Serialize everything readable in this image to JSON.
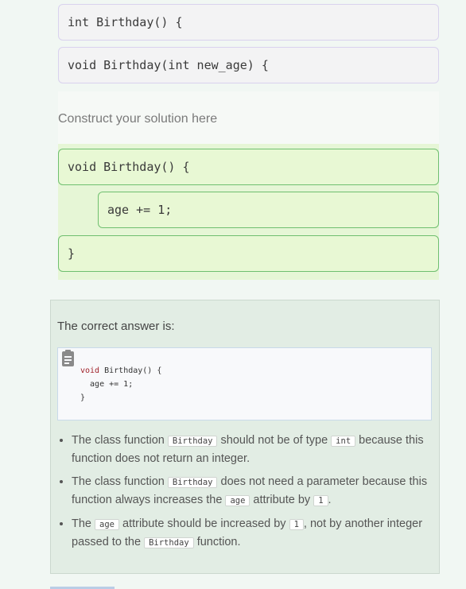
{
  "source_blocks": [
    "int Birthday() {",
    "void Birthday(int new_age) {"
  ],
  "construct_label": "Construct your solution here",
  "solution_blocks": [
    "void Birthday() {",
    "age += 1;",
    "}"
  ],
  "feedback": {
    "title": "The correct answer is:",
    "code_lines": [
      "void Birthday() {",
      "  age += 1;",
      "}"
    ],
    "code_keyword": "void",
    "bullets": [
      {
        "p1": "The class function ",
        "c1": "Birthday",
        "p2": " should not be of type ",
        "c2": "int",
        "p3": " because this function does not return an integer."
      },
      {
        "p1": "The class function ",
        "c1": "Birthday",
        "p2": " does not need a parameter because this function always increases the ",
        "c2": "age",
        "p3": " attribute by ",
        "c3": "1",
        "p4": "."
      },
      {
        "p1": "The ",
        "c1": "age",
        "p2": " attribute should be increased by ",
        "c2": "1",
        "p3": ", not by another integer passed to the ",
        "c3": "Birthday",
        "p4": " function."
      }
    ]
  },
  "icons": {
    "copy": "clipboard-icon"
  }
}
